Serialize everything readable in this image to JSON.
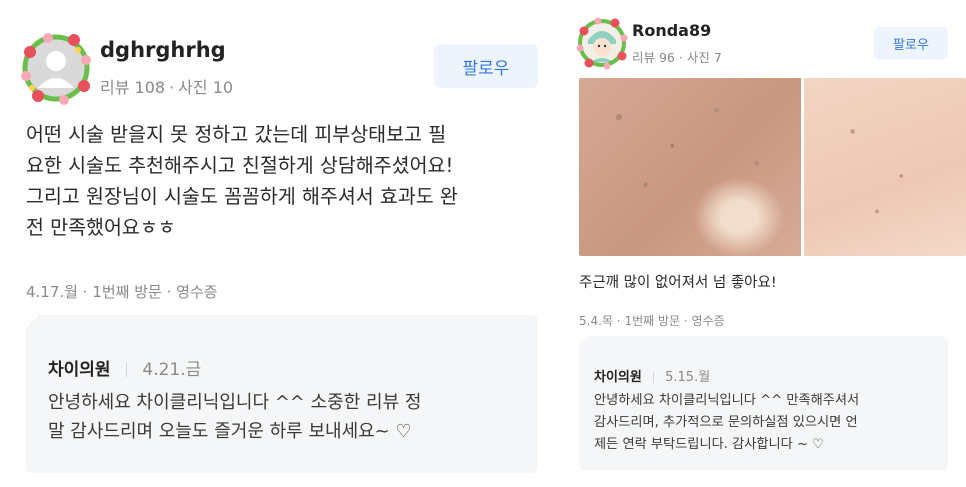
{
  "left": {
    "user": {
      "name": "dghrghrhg",
      "review_count_label": "리뷰 108",
      "dot": "·",
      "photo_count_label": "사진 10"
    },
    "follow_label": "팔로우",
    "review_lines": [
      "어떤 시술 받을지 못 정하고 갔는데 피부상태보고 필",
      "요한 시술도 추천해주시고 친절하게 상담해주셨어요!",
      "그리고 원장님이 시술도 꼼꼼하게 해주셔서 효과도 완",
      "전 만족했어요ㅎㅎ"
    ],
    "meta": {
      "date": "4.17.월",
      "dot1": "·",
      "visit": "1번째 방문",
      "dot2": "·",
      "receipt": "영수증"
    },
    "reply": {
      "author": "차이의원",
      "date": "4.21.금",
      "lines": [
        "안녕하세요 차이클리닉입니다 ^^ 소중한 리뷰 정",
        "말 감사드리며 오늘도 즐거운 하루 보내세요~ ♡"
      ]
    }
  },
  "right": {
    "user": {
      "name": "Ronda89",
      "review_count_label": "리뷰 96",
      "dot": "·",
      "photo_count_label": "사진 7"
    },
    "follow_label": "팔로우",
    "review_lines": [
      "주근깨 많이 없어져서 넘 좋아요!"
    ],
    "meta": {
      "date": "5.4.목",
      "dot1": "·",
      "visit": "1번째 방문",
      "dot2": "·",
      "receipt": "영수증"
    },
    "reply": {
      "author": "차이의원",
      "date": "5.15.월",
      "lines": [
        "안녕하세요 차이클리닉입니다 ^^ 만족해주셔서",
        "감사드리며, 추가적으로 문의하실점 있으시면 언",
        "제든 연락 부탁드립니다. 감사합니다 ~ ♡"
      ]
    }
  },
  "colors": {
    "follow_bg": "#eef4fd",
    "follow_text": "#3478e3",
    "reply_bg": "#f4f6f7",
    "muted_text": "#8a8a8a",
    "flower_red": "#e8505b",
    "leaf_green": "#6abf4b"
  },
  "icons": {
    "left_avatar": "flower-wreath-default-avatar-icon",
    "right_avatar": "flower-wreath-character-avatar-icon"
  }
}
